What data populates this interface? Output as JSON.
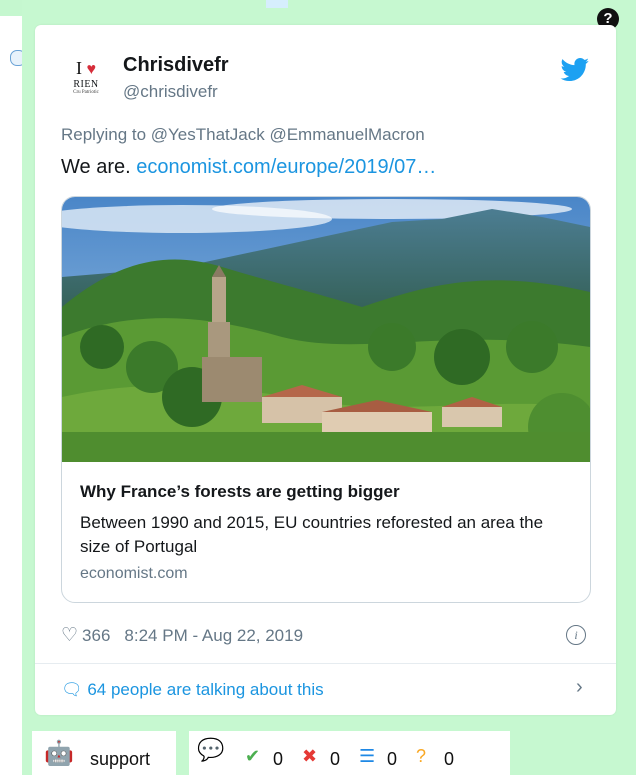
{
  "help_label": "?",
  "tweet": {
    "avatar": {
      "line1": "I",
      "heart": "♥",
      "line2": "RIEN",
      "line3": "Cru Patriotic"
    },
    "author_name": "Chrisdivefr",
    "author_handle": "@chrisdivefr",
    "replying_to": "Replying to @YesThatJack @EmmanuelMacron",
    "text_prefix": "We are. ",
    "text_link": "economist.com/europe/2019/07…",
    "card": {
      "title": "Why France’s forests are getting bigger",
      "description": "Between 1990 and 2015, EU countries reforested an area the size of Portugal",
      "domain": "economist.com"
    },
    "likes": "366",
    "timestamp": "8:24 PM - Aug 22, 2019",
    "talking": "64 people are talking about this",
    "colors": {
      "link": "#1b95e0",
      "muted": "#657786",
      "panel": "#c6f8d0"
    }
  },
  "footer": {
    "support_label": "support",
    "stats": [
      {
        "icon": "check-circle-icon",
        "glyph": "✔",
        "color": "#4caf50",
        "value": "0"
      },
      {
        "icon": "x-circle-icon",
        "glyph": "✖",
        "color": "#e53935",
        "value": "0"
      },
      {
        "icon": "list-circle-icon",
        "glyph": "☰",
        "color": "#1e88e5",
        "value": "0"
      },
      {
        "icon": "question-circle-icon",
        "glyph": "?",
        "color": "#f9a825",
        "value": "0"
      }
    ]
  }
}
